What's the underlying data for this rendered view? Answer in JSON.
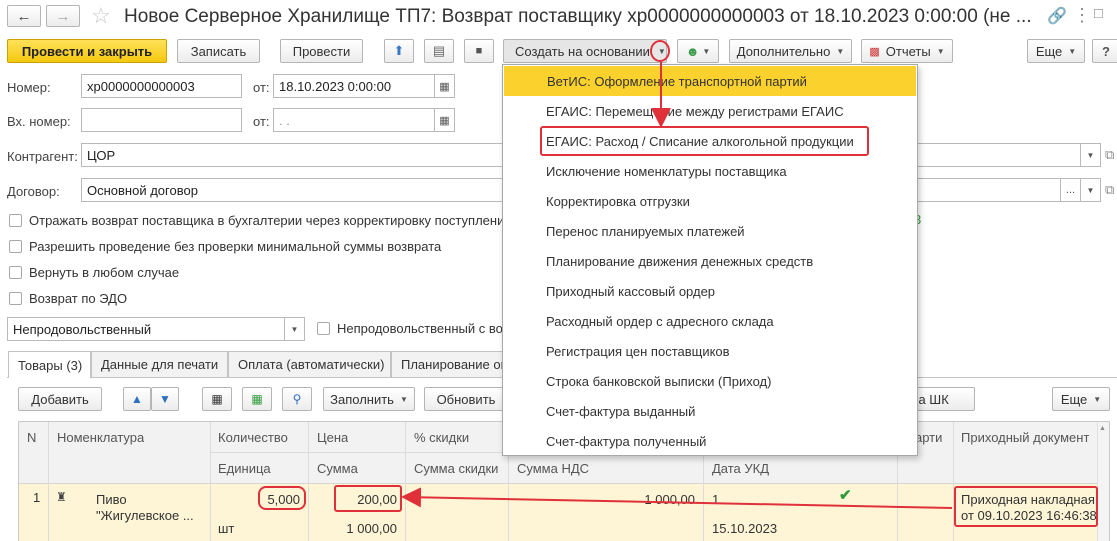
{
  "window": {
    "title": "Новое Серверное Хранилище ТП7: Возврат поставщику хр0000000000003 от 18.10.2023 0:00:00 (не ..."
  },
  "toolbar": {
    "post_close": "Провести и закрыть",
    "save": "Записать",
    "post": "Провести",
    "create_based": "Создать на основании",
    "additional": "Дополнительно",
    "reports": "Отчеты",
    "more": "Еще"
  },
  "form": {
    "number_label": "Номер:",
    "number_value": "хр0000000000003",
    "from_label": "от:",
    "date_value": "18.10.2023  0:00:00",
    "in_number_label": "Вх. номер:",
    "in_number_value": "",
    "in_from_label": "от:",
    "in_date_value": " .  .",
    "counterparty_label": "Контрагент:",
    "counterparty_value": "ЦОР",
    "contract_label": "Договор:",
    "contract_value": "Основной договор",
    "checkboxes": [
      "Отражать возврат поставщика в бухгалтерии через корректировку поступления",
      "Разрешить проведение без проверки минимальной суммы возврата",
      "Вернуть в любом случае",
      "Возврат по ЭДО"
    ],
    "category_value": "Непродовольственный",
    "nonfood_checkbox": "Непродовольственный с во",
    "right_fragment": "3"
  },
  "tabs": [
    "Товары (3)",
    "Данные для печати",
    "Оплата (автоматически)",
    "Планирование ог"
  ],
  "table_toolbar": {
    "add": "Добавить",
    "fill": "Заполнить",
    "refresh": "Обновить",
    "barcode": "ера ШК",
    "more": "Еще"
  },
  "table": {
    "headers_row1": [
      "N",
      "Номенклатура",
      "Количество",
      "Цена",
      "% скидки",
      "",
      "",
      "",
      "арти",
      "Приходный документ"
    ],
    "headers_row2": [
      "Единица",
      "Сумма",
      "Сумма скидки",
      "Сумма НДС",
      "",
      "Дата УКД"
    ],
    "rows": [
      {
        "n": "1",
        "name_line1": "Пиво",
        "name_line2": "\"Жигулевское ...",
        "quantity": "5,000",
        "unit": "шт",
        "price": "200,00",
        "sum": "1 000,00",
        "total": "1 000,00",
        "ukd": "1",
        "ukd_date": "15.10.2023",
        "doc_line1": "Приходная накладная",
        "doc_line2": "от 09.10.2023 16:46:38"
      }
    ]
  },
  "dropdown_menu": {
    "items": [
      "ВетИС: Оформление транспортной партий",
      "ЕГАИС: Перемещение между регистрами ЕГАИС",
      "ЕГАИС: Расход / Списание алкогольной продукции",
      "Исключение номенклатуры поставщика",
      "Корректировка отгрузки",
      "Перенос планируемых платежей",
      "Планирование движения денежных средств",
      "Приходный кассовый ордер",
      "Расходный ордер с адресного склада",
      "Регистрация цен поставщиков",
      "Строка банковской выписки (Приход)",
      "Счет-фактура выданный",
      "Счет-фактура полученный"
    ]
  },
  "colors": {
    "accent_yellow": "#f5c810",
    "highlight_menu": "#fbd12d",
    "row_highlight": "#fdf5d6",
    "annotation_red": "#e0313a",
    "check_green": "#2e9a3a"
  }
}
